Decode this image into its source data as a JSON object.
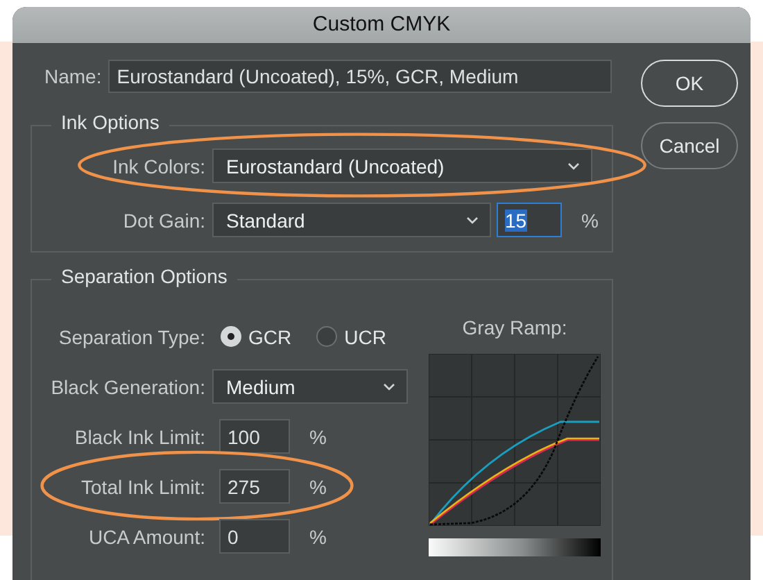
{
  "window": {
    "title": "Custom CMYK"
  },
  "name": {
    "label": "Name:",
    "value": "Eurostandard (Uncoated), 15%, GCR, Medium"
  },
  "buttons": [
    {
      "label": "OK",
      "default": true
    },
    {
      "label": "Cancel",
      "default": false
    }
  ],
  "ink_options": {
    "title": "Ink Options",
    "rows": [
      {
        "kind": "dropdown",
        "label": "Ink Colors:",
        "value": "Eurostandard (Uncoated)",
        "circled": true
      },
      {
        "kind": "dropdown-percent",
        "label": "Dot Gain:",
        "value": "Standard",
        "percent_value": "15",
        "percent_selected": true,
        "unit": "%",
        "circled": false
      }
    ]
  },
  "separation_options": {
    "title": "Separation Options",
    "rows": [
      {
        "kind": "radio",
        "label": "Separation Type:",
        "options": [
          {
            "label": "GCR",
            "selected": true
          },
          {
            "label": "UCR",
            "selected": false
          }
        ],
        "circled": false
      },
      {
        "kind": "dropdown",
        "label": "Black Generation:",
        "value": "Medium",
        "circled": false
      },
      {
        "kind": "percent",
        "label": "Black Ink Limit:",
        "value": "100",
        "unit": "%",
        "circled": false
      },
      {
        "kind": "percent",
        "label": "Total Ink Limit:",
        "value": "275",
        "unit": "%",
        "circled": true
      },
      {
        "kind": "percent",
        "label": "UCA Amount:",
        "value": "0",
        "unit": "%",
        "circled": false
      }
    ],
    "gray_ramp": {
      "label": "Gray Ramp:"
    }
  }
}
